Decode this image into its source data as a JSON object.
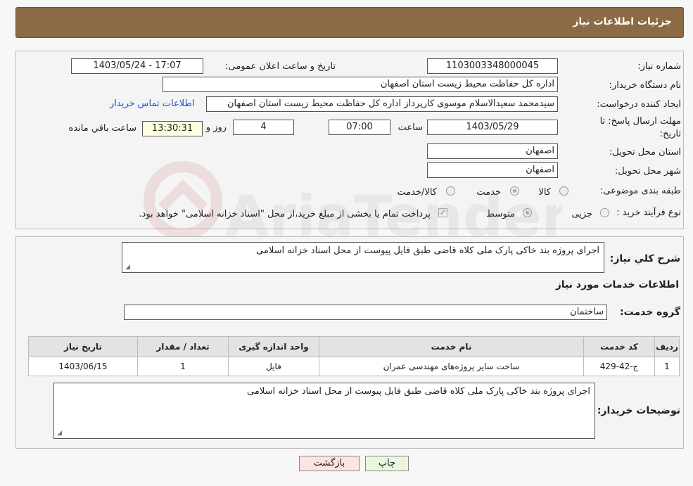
{
  "header": {
    "title": "جزئیات اطلاعات نیاز"
  },
  "info": {
    "need_number_label": "شماره نیاز:",
    "need_number": "1103003348000045",
    "announce_label": "تاریخ و ساعت اعلان عمومی:",
    "announce_value": "1403/05/24 - 17:07",
    "buyer_label": "نام دستگاه خریدار:",
    "buyer_value": "اداره کل حفاظت محیط زیست استان اصفهان",
    "creator_label": "ایجاد کننده درخواست:",
    "creator_value": "سیدمحمد سعیدالاسلام موسوی کارپرداز اداره کل حفاظت محیط زیست استان اصفهان",
    "contact_link": "اطلاعات تماس خریدار",
    "deadline_label_1": "مهلت ارسال پاسخ: تا",
    "deadline_label_2": "تاریخ:",
    "deadline_date": "1403/05/29",
    "time_label": "ساعت",
    "deadline_time": "07:00",
    "days_value": "4",
    "days_label": "روز و",
    "remaining_time": "13:30:31",
    "remaining_label": "ساعت باقي مانده",
    "province_label": "استان محل تحویل:",
    "province_value": "اصفهان",
    "city_label": "شهر محل تحویل:",
    "city_value": "اصفهان",
    "category_label": "طبقه بندی موضوعی:",
    "category_options": [
      "کالا",
      "خدمت",
      "کالا/خدمت"
    ],
    "process_label": "نوع فرآیند خرید :",
    "process_options": [
      "جزیی",
      "متوسط"
    ],
    "payment_note": "پرداخت تمام یا بخشی از مبلغ خرید،از محل \"اسناد خزانه اسلامی\" خواهد بود."
  },
  "details": {
    "summary_label": "شرح کلي نياز:",
    "summary_value": "اجرای پروژه بند خاکی پارک ملی کلاه قاضی طبق فایل پیوست از محل اسناد خزانه اسلامی",
    "services_title": "اطلاعات خدمات مورد نياز",
    "group_label": "گروه خدمت:",
    "group_value": "ساختمان",
    "table": {
      "headers": [
        "ردیف",
        "کد خدمت",
        "نام خدمت",
        "واحد اندازه گیری",
        "تعداد / مقدار",
        "تاریخ نیاز"
      ],
      "rows": [
        [
          "1",
          "ج-42-429",
          "ساخت سایر پروژه‌های مهندسی عمران",
          "فایل",
          "1",
          "1403/06/15"
        ]
      ]
    },
    "buyer_notes_label": "توضیحات خریدار:",
    "buyer_notes_value": "اجرای پروژه بند خاکی پارک ملی کلاه قاضی طبق فایل پیوست از محل اسناد خزانه اسلامی"
  },
  "buttons": {
    "print": "چاپ",
    "back": "بازگشت"
  },
  "watermark": {
    "text": "AriaTender.neT"
  },
  "colors": {
    "header_bg": "#8c6a46",
    "link": "#1a4fd6",
    "print_btn": "#eaf6e0",
    "back_btn": "#fbe4e4"
  }
}
